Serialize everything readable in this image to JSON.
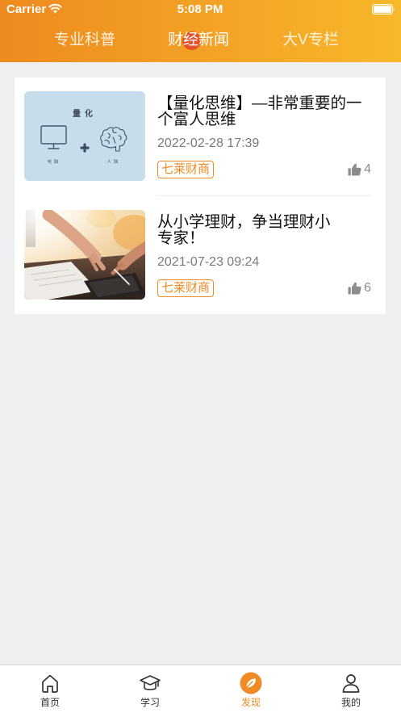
{
  "status_bar": {
    "carrier": "Carrier",
    "time": "5:08 PM"
  },
  "header": {
    "tabs": [
      {
        "label": "专业科普",
        "selected": false
      },
      {
        "label": "财经新闻",
        "selected": true
      },
      {
        "label": "大V专栏",
        "selected": false
      }
    ]
  },
  "news": {
    "items": [
      {
        "title_lines": [
          "【量化思维】—非常重要的一",
          "个富人思维"
        ],
        "date": "2022-02-28 17:39",
        "tag": "七莱财商",
        "likes": 4,
        "thumbnail_text": {
          "heading": "量化",
          "left_label": "电脑",
          "right_label": "人脑"
        }
      },
      {
        "title_lines": [
          "从小学理财，争当理财小",
          "专家！"
        ],
        "date": "2021-07-23 09:24",
        "tag": "七莱财商",
        "likes": 6
      }
    ]
  },
  "tab_bar": {
    "items": [
      {
        "label": "首页",
        "icon": "home-icon",
        "selected": false
      },
      {
        "label": "学习",
        "icon": "graduation-cap-icon",
        "selected": false
      },
      {
        "label": "发现",
        "icon": "discover-leaf-icon",
        "selected": true
      },
      {
        "label": "我的",
        "icon": "user-icon",
        "selected": false
      }
    ]
  },
  "icons": {
    "like": "thumbs-up-icon",
    "wifi": "wifi-icon",
    "battery": "battery-icon"
  },
  "colors": {
    "header_gradient_start": "#EE8A1F",
    "header_gradient_end": "#F7B82B",
    "accent": "#F08A24",
    "tab_indicator": "#E8502B",
    "background": "#EFEFF1"
  }
}
